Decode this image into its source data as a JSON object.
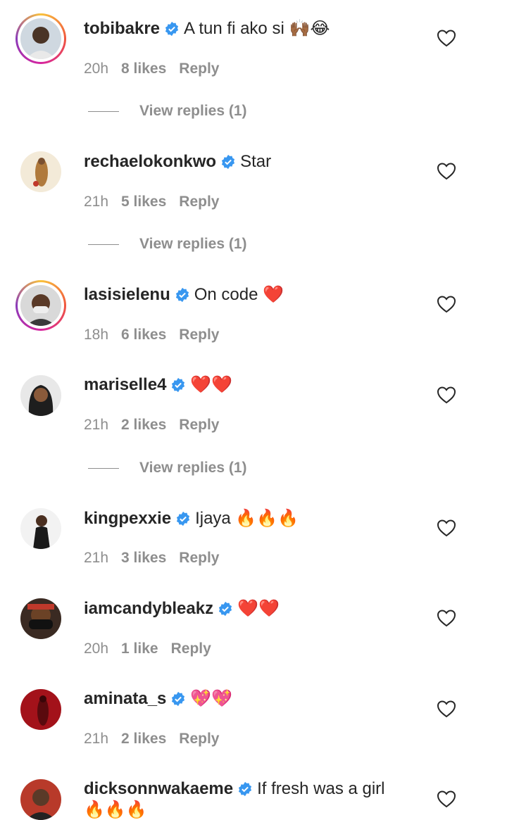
{
  "colors": {
    "text": "#262626",
    "muted": "#8e8e8e",
    "verified": "#3897f0",
    "ring_gradient": [
      "#f9c23c",
      "#f0553d",
      "#d6249f",
      "#8a3ab9"
    ]
  },
  "comments": [
    {
      "username": "tobibakre",
      "text": "A tun fi ako si 🙌🏾😂",
      "time": "20h",
      "likes": "8 likes",
      "reply": "Reply",
      "view_replies": "View replies (1)",
      "story_ring": true,
      "avatar_icon": "avatar-man-icon"
    },
    {
      "username": "rechaelokonkwo",
      "text": "Star",
      "time": "21h",
      "likes": "5 likes",
      "reply": "Reply",
      "view_replies": "View replies (1)",
      "story_ring": false,
      "avatar_icon": "avatar-woman-icon"
    },
    {
      "username": "lasisielenu",
      "text": "On code ❤️",
      "time": "18h",
      "likes": "6 likes",
      "reply": "Reply",
      "view_replies": "",
      "story_ring": true,
      "avatar_icon": "avatar-man-icon"
    },
    {
      "username": "mariselle4",
      "text": "❤️❤️",
      "time": "21h",
      "likes": "2 likes",
      "reply": "Reply",
      "view_replies": "View replies (1)",
      "story_ring": false,
      "avatar_icon": "avatar-woman-icon"
    },
    {
      "username": "kingpexxie",
      "text": "Ijaya 🔥🔥🔥",
      "time": "21h",
      "likes": "3 likes",
      "reply": "Reply",
      "view_replies": "",
      "story_ring": false,
      "avatar_icon": "avatar-man-icon"
    },
    {
      "username": "iamcandybleakz",
      "text": "❤️❤️",
      "time": "20h",
      "likes": "1 like",
      "reply": "Reply",
      "view_replies": "",
      "story_ring": false,
      "avatar_icon": "avatar-man-icon"
    },
    {
      "username": "aminata_s",
      "text": "💖💖",
      "time": "21h",
      "likes": "2 likes",
      "reply": "Reply",
      "view_replies": "",
      "story_ring": false,
      "avatar_icon": "avatar-woman-icon"
    },
    {
      "username": "dicksonnwakaeme",
      "text": "If fresh was a girl 🔥🔥🔥",
      "time": "",
      "likes": "",
      "reply": "",
      "view_replies": "",
      "story_ring": false,
      "avatar_icon": "avatar-man-icon"
    }
  ]
}
